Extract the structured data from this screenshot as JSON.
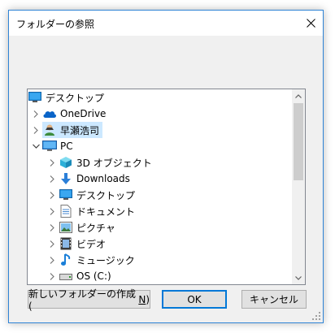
{
  "window": {
    "title": "フォルダーの参照"
  },
  "tree": {
    "items": [
      {
        "label": "デスクトップ",
        "icon": "desktop-icon",
        "level": 0,
        "chevron": "none"
      },
      {
        "label": "OneDrive",
        "icon": "onedrive-cloud-icon",
        "level": 1,
        "chevron": "collapsed"
      },
      {
        "label": "早瀬浩司",
        "icon": "user-folder-icon",
        "level": 1,
        "chevron": "collapsed",
        "selected": true
      },
      {
        "label": "PC",
        "icon": "pc-icon",
        "level": 1,
        "chevron": "expanded"
      },
      {
        "label": "3D オブジェクト",
        "icon": "3d-objects-icon",
        "level": 2,
        "chevron": "collapsed"
      },
      {
        "label": "Downloads",
        "icon": "downloads-icon",
        "level": 2,
        "chevron": "collapsed"
      },
      {
        "label": "デスクトップ",
        "icon": "desktop-icon",
        "level": 2,
        "chevron": "collapsed"
      },
      {
        "label": "ドキュメント",
        "icon": "documents-icon",
        "level": 2,
        "chevron": "collapsed"
      },
      {
        "label": "ピクチャ",
        "icon": "pictures-icon",
        "level": 2,
        "chevron": "collapsed"
      },
      {
        "label": "ビデオ",
        "icon": "videos-icon",
        "level": 2,
        "chevron": "collapsed"
      },
      {
        "label": "ミュージック",
        "icon": "music-icon",
        "level": 2,
        "chevron": "collapsed"
      },
      {
        "label": "OS (C:)",
        "icon": "drive-icon",
        "level": 2,
        "chevron": "collapsed"
      }
    ]
  },
  "buttons": {
    "new_folder": {
      "label": "新しいフォルダーの作成(",
      "accel": "N",
      "suffix": ")"
    },
    "ok": "OK",
    "cancel": "キャンセル"
  },
  "colors": {
    "accent": "#0078d7",
    "selection": "#cce8ff"
  }
}
